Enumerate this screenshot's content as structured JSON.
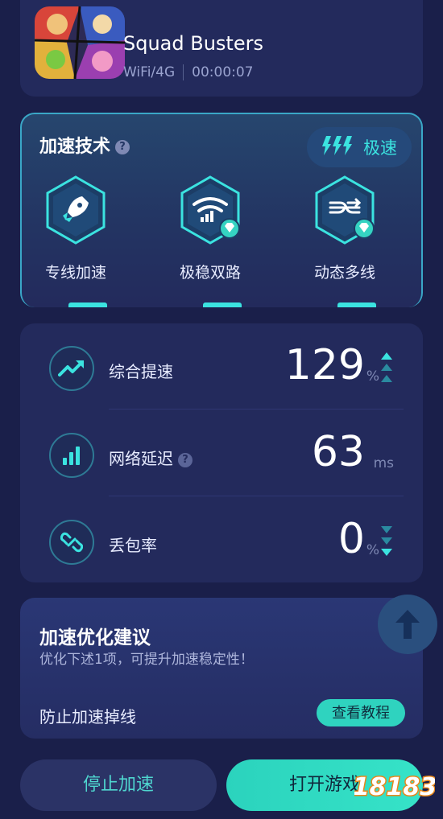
{
  "game": {
    "title": "Squad Busters",
    "network": "WiFi/4G",
    "timer": "00:00:07"
  },
  "tech": {
    "title": "加速技术",
    "mode_label": "极速",
    "items": [
      {
        "label": "专线加速",
        "icon": "rocket-icon",
        "premium": false
      },
      {
        "label": "极稳双路",
        "icon": "dual-wifi-icon",
        "premium": true
      },
      {
        "label": "动态多线",
        "icon": "multiline-icon",
        "premium": true
      }
    ]
  },
  "stats": [
    {
      "label": "综合提速",
      "value": "129",
      "unit": "%",
      "icon": "trend-up-icon",
      "arrows": "up",
      "help": false
    },
    {
      "label": "网络延迟",
      "value": "63",
      "unit": "ms",
      "icon": "signal-bars-icon",
      "arrows": "none",
      "help": true
    },
    {
      "label": "丢包率",
      "value": "0",
      "unit": "%",
      "icon": "broken-link-icon",
      "arrows": "down",
      "help": false
    }
  ],
  "suggestion": {
    "title": "加速优化建议",
    "subtitle": "优化下述1项，可提升加速稳定性！",
    "item_label": "防止加速掉线",
    "button_label": "查看教程"
  },
  "bottom": {
    "stop_label": "停止加速",
    "open_label": "打开游戏"
  },
  "watermark": "18183",
  "colors": {
    "accent": "#3be3e0",
    "background": "#1a1f4a",
    "card": "#232a5c",
    "primary_button": "#2bd3bd"
  }
}
